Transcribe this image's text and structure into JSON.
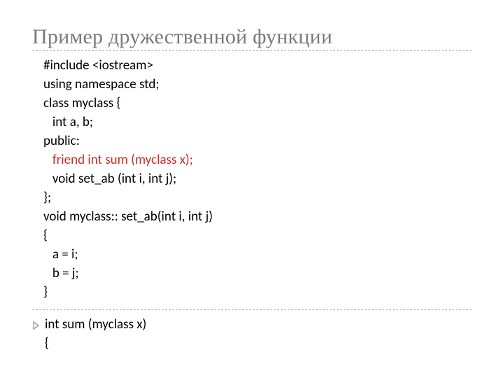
{
  "title": "Пример дружественной функции",
  "code": {
    "l1": "#include <iostream>",
    "l2": "using namespace std;",
    "l3": "class myclass {",
    "l4": "   int a, b;",
    "l5": "public:",
    "l6": "   friend int sum (myclass x);",
    "l7": "   void set_ab (int i, int j);",
    "l8": "};",
    "l9": "void myclass:: set_ab(int i, int j)",
    "l10": "{",
    "l11": "   a = i;",
    "l12": "   b = j;",
    "l13": "}"
  },
  "bullet": {
    "l1": "int sum (myclass x)",
    "l2": "{"
  }
}
